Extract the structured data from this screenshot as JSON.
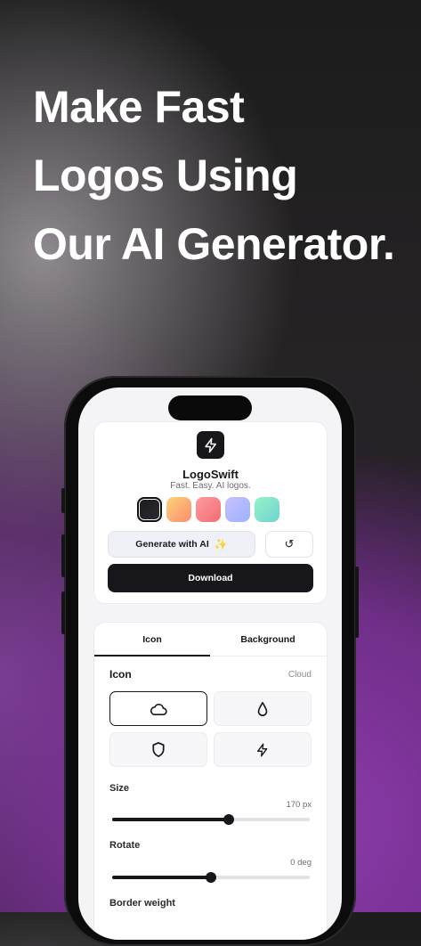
{
  "headline": [
    "Make Fast",
    "Logos Using",
    "Our AI Generator."
  ],
  "app": {
    "name": "LogoSwift",
    "tagline": "Fast. Easy. AI logos.",
    "app_icon": "lightning-bolt-icon"
  },
  "swatches": [
    {
      "name": "black",
      "colors": [
        "#1b1b1f",
        "#2b2b30"
      ],
      "selected": true
    },
    {
      "name": "orange",
      "colors": [
        "#fcd37a",
        "#f98d6e"
      ],
      "selected": false
    },
    {
      "name": "coral",
      "colors": [
        "#fb9ba0",
        "#f56c74"
      ],
      "selected": false
    },
    {
      "name": "lavender",
      "colors": [
        "#c5c0ff",
        "#9fb2ff"
      ],
      "selected": false
    },
    {
      "name": "mint",
      "colors": [
        "#95f2c8",
        "#6fd3cf"
      ],
      "selected": false
    }
  ],
  "buttons": {
    "generate_label": "Generate with AI",
    "generate_icon": "sparkle-icon",
    "reset_icon": "refresh-icon",
    "download_label": "Download"
  },
  "tabs": [
    {
      "label": "Icon",
      "active": true
    },
    {
      "label": "Background",
      "active": false
    }
  ],
  "icon_section": {
    "title": "Icon",
    "selected_value": "Cloud",
    "options": [
      {
        "icon": "cloud-icon",
        "selected": true
      },
      {
        "icon": "droplet-icon",
        "selected": false
      },
      {
        "icon": "shield-icon",
        "selected": false
      },
      {
        "icon": "lightning-bolt-icon",
        "selected": false
      }
    ]
  },
  "controls": {
    "size": {
      "label": "Size",
      "readout": "170 px",
      "fraction": 0.59
    },
    "rotate": {
      "label": "Rotate",
      "readout": "0 deg",
      "fraction": 0.5
    },
    "border_weight": {
      "label": "Border weight"
    }
  }
}
